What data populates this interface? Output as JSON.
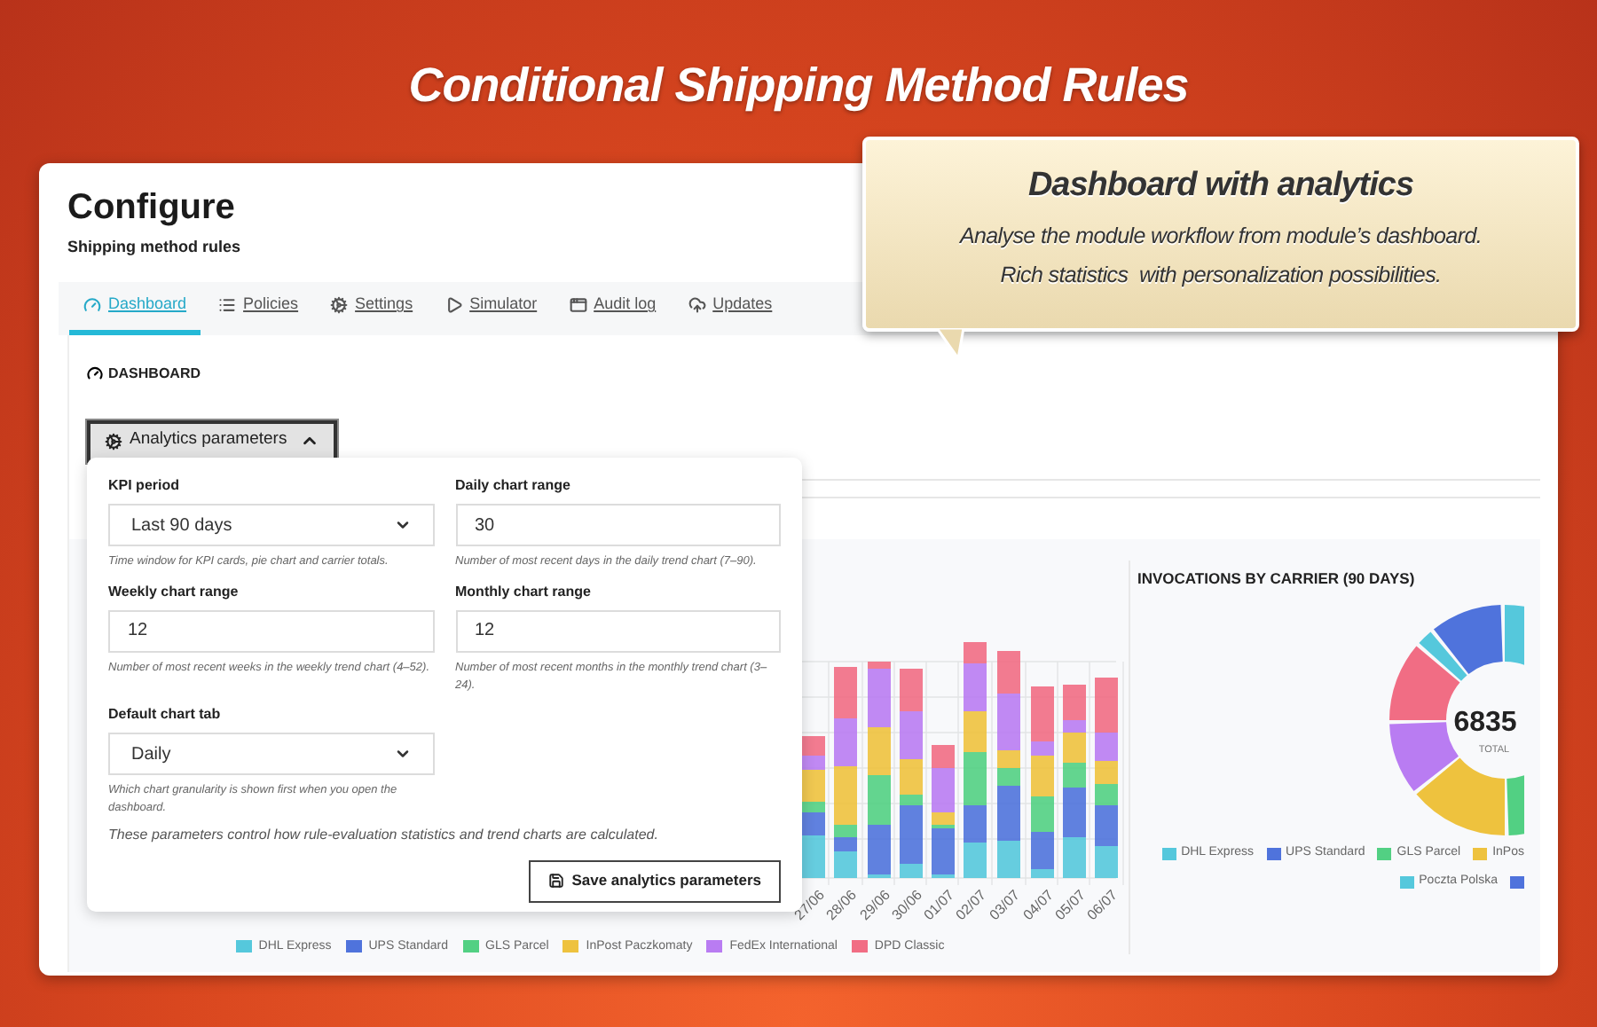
{
  "banner": {
    "title": "Conditional Shipping Method Rules"
  },
  "callout": {
    "title": "Dashboard with analytics",
    "lines": [
      "Analyse the module workflow from module’s dashboard.",
      "Rich statistics  with personalization possibilities."
    ]
  },
  "page": {
    "title": "Configure",
    "subtitle": "Shipping method rules"
  },
  "tabs": [
    {
      "label": "Dashboard",
      "selected": true
    },
    {
      "label": "Policies",
      "selected": false
    },
    {
      "label": "Settings",
      "selected": false
    },
    {
      "label": "Simulator",
      "selected": false
    },
    {
      "label": "Audit log",
      "selected": false
    },
    {
      "label": "Updates",
      "selected": false
    }
  ],
  "section": {
    "title": "DASHBOARD"
  },
  "analytics_button": {
    "label": "Analytics parameters",
    "expanded": true
  },
  "analytics_panel": {
    "fields": [
      {
        "kind": "select",
        "label": "KPI period",
        "value": "Last 90 days",
        "help": "Time window for KPI cards, pie chart and carrier totals."
      },
      {
        "kind": "input",
        "label": "Daily chart range",
        "value": "30",
        "help": "Number of most recent days in the daily trend chart (7–90)."
      },
      {
        "kind": "input",
        "label": "Weekly chart range",
        "value": "12",
        "help": "Number of most recent weeks in the weekly trend chart (4–52)."
      },
      {
        "kind": "input",
        "label": "Monthly chart range",
        "value": "12",
        "help": "Number of most recent months in the monthly trend chart (3–24)."
      },
      {
        "kind": "select",
        "label": "Default chart tab",
        "value": "Daily",
        "help": "Which chart granularity is shown first when you open the dashboard."
      }
    ],
    "note": "These parameters control how rule-evaluation statistics and trend charts are calculated.",
    "save_button": "Save analytics parameters"
  },
  "daily_chart": {
    "x_labels": [
      "27/06",
      "28/06",
      "29/06",
      "30/06",
      "01/07",
      "02/07",
      "03/07",
      "04/07",
      "05/07",
      "06/07"
    ],
    "legend": [
      {
        "label": "DHL Express",
        "color": "#55c8dc"
      },
      {
        "label": "UPS Standard",
        "color": "#4f73dc"
      },
      {
        "label": "GLS Parcel",
        "color": "#52d083"
      },
      {
        "label": "InPost Paczkomaty",
        "color": "#eec23e"
      },
      {
        "label": "FedEx International",
        "color": "#b97cf2"
      },
      {
        "label": "DPD Classic",
        "color": "#f16d84"
      }
    ]
  },
  "carrier_chart": {
    "title": "INVOCATIONS BY CARRIER (90 DAYS)",
    "total": "6835",
    "total_label": "TOTAL",
    "legend": [
      {
        "label": "DHL Express",
        "color": "#55c8dc"
      },
      {
        "label": "UPS Standard",
        "color": "#4f73dc"
      },
      {
        "label": "GLS Parcel",
        "color": "#52d083"
      },
      {
        "label": "InPos",
        "color": "#eec23e"
      },
      {
        "label": "Poczta Polska",
        "color": "#55c8dc"
      },
      {
        "color": "#4f73dc"
      }
    ]
  }
}
